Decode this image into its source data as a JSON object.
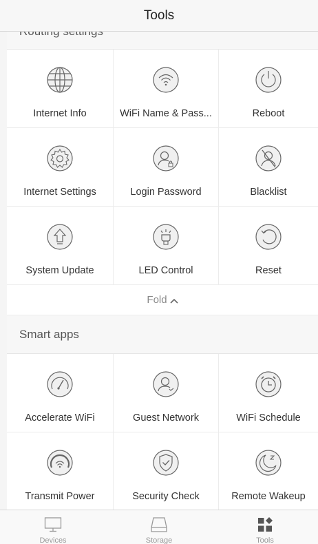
{
  "nav": {
    "title": "Tools"
  },
  "routing": {
    "section_label": "Routing settings",
    "items": [
      {
        "label": "Internet Info",
        "icon": "globe-icon"
      },
      {
        "label": "WiFi Name & Pass...",
        "icon": "wifi-icon"
      },
      {
        "label": "Reboot",
        "icon": "power-icon"
      },
      {
        "label": "Internet Settings",
        "icon": "gear-icon"
      },
      {
        "label": "Login Password",
        "icon": "user-lock-icon"
      },
      {
        "label": "Blacklist",
        "icon": "user-block-icon"
      },
      {
        "label": "System Update",
        "icon": "arrow-up-icon"
      },
      {
        "label": "LED Control",
        "icon": "bulb-icon"
      },
      {
        "label": "Reset",
        "icon": "reset-icon"
      }
    ]
  },
  "fold": {
    "label": "Fold",
    "chevron": "^"
  },
  "smart": {
    "section_label": "Smart apps",
    "items": [
      {
        "label": "Accelerate WiFi",
        "icon": "speedometer-icon"
      },
      {
        "label": "Guest Network",
        "icon": "guest-icon"
      },
      {
        "label": "WiFi Schedule",
        "icon": "alarm-clock-icon"
      },
      {
        "label": "Transmit Power",
        "icon": "signal-dial-icon"
      },
      {
        "label": "Security Check",
        "icon": "shield-check-icon"
      },
      {
        "label": "Remote Wakeup",
        "icon": "moon-z-icon"
      }
    ]
  },
  "tabbar": {
    "tabs": [
      {
        "label": "Devices",
        "icon": "monitor-icon",
        "active": false
      },
      {
        "label": "Storage",
        "icon": "drive-icon",
        "active": false
      },
      {
        "label": "Tools",
        "icon": "grid-tools-icon",
        "active": true
      }
    ]
  },
  "colors": {
    "icon_stroke": "#666666",
    "icon_fill": "#f0f0f0",
    "active_tab": "#555555",
    "inactive_tab": "#999999"
  }
}
